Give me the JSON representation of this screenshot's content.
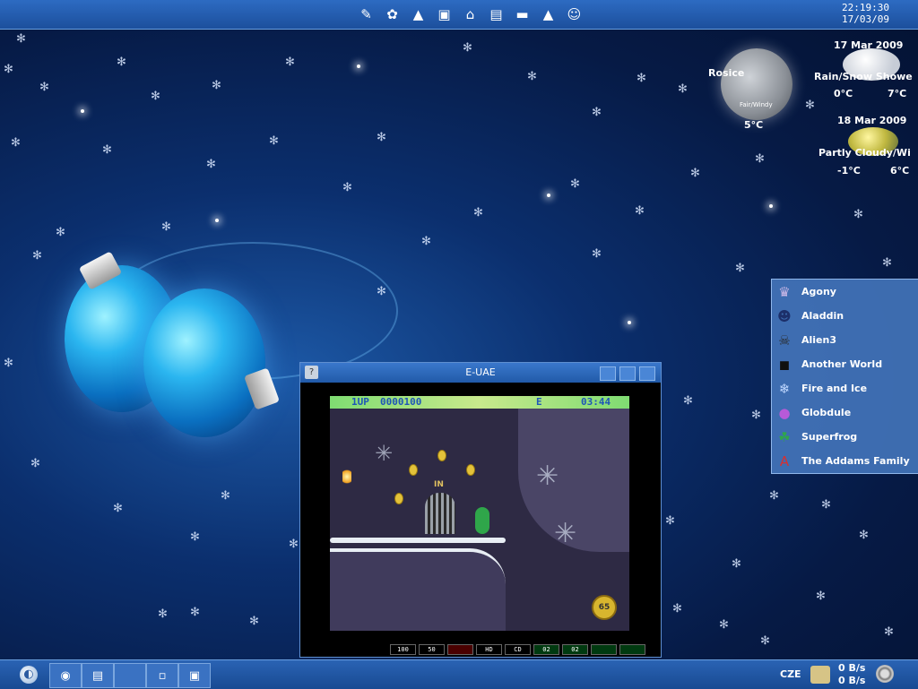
{
  "top_panel": {
    "launchers": [
      {
        "name": "text-editor-icon",
        "glyph": "✎"
      },
      {
        "name": "dragon-app-icon",
        "glyph": "✿"
      },
      {
        "name": "inkscape-icon",
        "glyph": "▲"
      },
      {
        "name": "package-icon",
        "glyph": "▣"
      },
      {
        "name": "home-folder-icon",
        "glyph": "⌂"
      },
      {
        "name": "document-icon",
        "glyph": "▤"
      },
      {
        "name": "terminal-icon",
        "glyph": "▬"
      },
      {
        "name": "vlc-icon",
        "glyph": "▲"
      },
      {
        "name": "messenger-icon",
        "glyph": "☺"
      }
    ],
    "clock": {
      "time": "22:19:30",
      "date": "17/03/09"
    }
  },
  "weather": {
    "location": "Rosice",
    "current_label": "Fair/Windy",
    "current_temp": "5°C",
    "day1": {
      "date": "17 Mar 2009",
      "condition": "Rain/Snow Showe",
      "low": "0°C",
      "high": "7°C"
    },
    "day2": {
      "date": "18 Mar 2009",
      "condition": "Partly Cloudy/Wi",
      "low": "-1°C",
      "high": "6°C"
    }
  },
  "game_list": [
    {
      "label": "Agony",
      "icon": "agony-icon",
      "glyph": "♛",
      "color": "#c9b6e6"
    },
    {
      "label": "Aladdin",
      "icon": "aladdin-icon",
      "glyph": "☻",
      "color": "#1c2f6a"
    },
    {
      "label": "Alien3",
      "icon": "alien3-icon",
      "glyph": "☠",
      "color": "#2a2a2a"
    },
    {
      "label": "Another World",
      "icon": "another-world-icon",
      "glyph": "◼",
      "color": "#101010"
    },
    {
      "label": "Fire and Ice",
      "icon": "fire-and-ice-icon",
      "glyph": "❄",
      "color": "#bfd7ff"
    },
    {
      "label": "Globdule",
      "icon": "globdule-icon",
      "glyph": "●",
      "color": "#b75ad8"
    },
    {
      "label": "Superfrog",
      "icon": "superfrog-icon",
      "glyph": "☘",
      "color": "#2fa64a"
    },
    {
      "label": "The Addams Family",
      "icon": "addams-family-icon",
      "glyph": "A",
      "color": "#d83030"
    }
  ],
  "window": {
    "title": "E-UAE",
    "hud": {
      "player": "1UP",
      "score": "0000100",
      "energy": "E",
      "timer": "03:44"
    },
    "sign": "IN",
    "badge": "65",
    "leds": [
      "100",
      "50",
      "",
      "HD",
      "CD",
      "02",
      "02",
      "",
      ""
    ]
  },
  "bottom_panel": {
    "keyboard_layout": "CZE",
    "net_down": "0 B/s",
    "net_up": "0 B/s"
  }
}
